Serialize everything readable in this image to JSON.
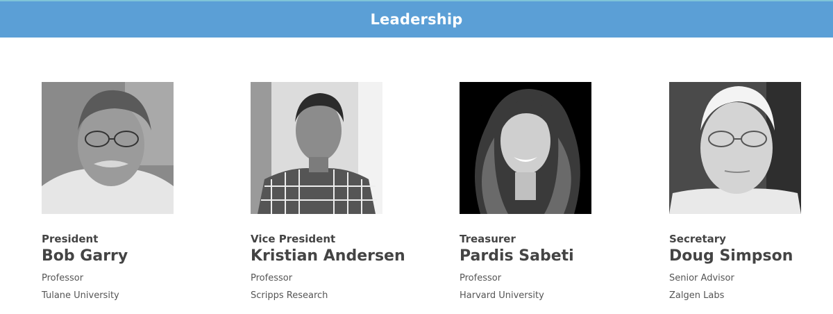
{
  "header": {
    "title": "Leadership"
  },
  "members": [
    {
      "role": "President",
      "name": "Bob Garry",
      "title": "Professor",
      "organization": "Tulane University",
      "photo_icon": "portrait-photo"
    },
    {
      "role": "Vice President",
      "name": "Kristian Andersen",
      "title": "Professor",
      "organization": "Scripps Research",
      "photo_icon": "portrait-photo"
    },
    {
      "role": "Treasurer",
      "name": "Pardis Sabeti",
      "title": "Professor",
      "organization": "Harvard University",
      "photo_icon": "portrait-photo"
    },
    {
      "role": "Secretary",
      "name": "Doug Simpson",
      "title": "Senior Advisor",
      "organization": "Zalgen Labs",
      "photo_icon": "portrait-photo"
    }
  ],
  "colors": {
    "header_bg": "#5b9fd6",
    "header_text": "#ffffff",
    "text": "#444444"
  }
}
